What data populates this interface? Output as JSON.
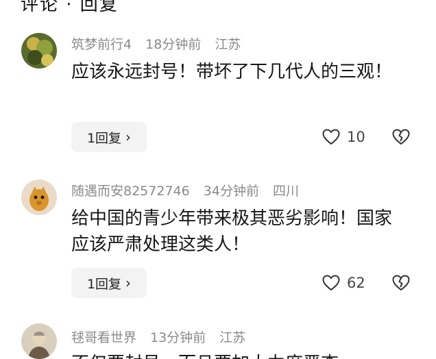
{
  "header_cut": "评论 · 回复",
  "comments": [
    {
      "username": "筑梦前行4",
      "time": "18分钟前",
      "location": "江苏",
      "text": "应该永远封号！带坏了下几代人的三观！",
      "reply_label": "1回复",
      "like_count": "10"
    },
    {
      "username": "随遇而安82572746",
      "time": "34分钟前",
      "location": "四川",
      "text": "给中国的青少年带来极其恶劣影响！国家应该严肃处理这类人！",
      "reply_label": "1回复",
      "like_count": "62"
    },
    {
      "username": "毬哥看世界",
      "time": "13分钟前",
      "location": "江苏",
      "text": "不仅要封号，而且要加大力度严查"
    }
  ],
  "icons": [
    "heart-icon",
    "broken-heart-icon",
    "chevron-right-icon"
  ]
}
